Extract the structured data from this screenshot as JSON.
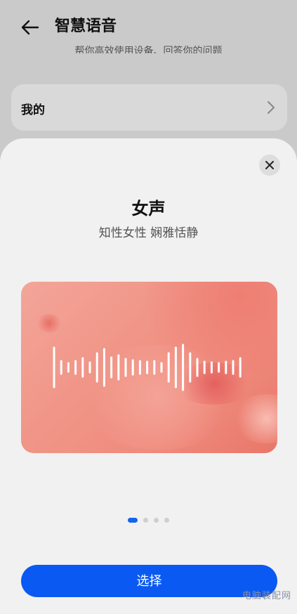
{
  "header": {
    "title": "智慧语音",
    "subtitle": "帮你高效使用设备、回答你的问题"
  },
  "list": {
    "mine_label": "我的"
  },
  "sheet": {
    "voice_name": "女声",
    "voice_description": "知性女性 娴雅恬静",
    "page_indicator": {
      "total": 4,
      "active_index": 0
    },
    "select_label": "选择"
  },
  "watermark": "电脑装配网",
  "colors": {
    "accent": "#0a59f2",
    "indicator_active": "#1565ea",
    "card_coral": "#ef8b7d"
  },
  "icons": [
    "back-arrow-icon",
    "chevron-right-icon",
    "close-icon",
    "waveform-icon"
  ]
}
